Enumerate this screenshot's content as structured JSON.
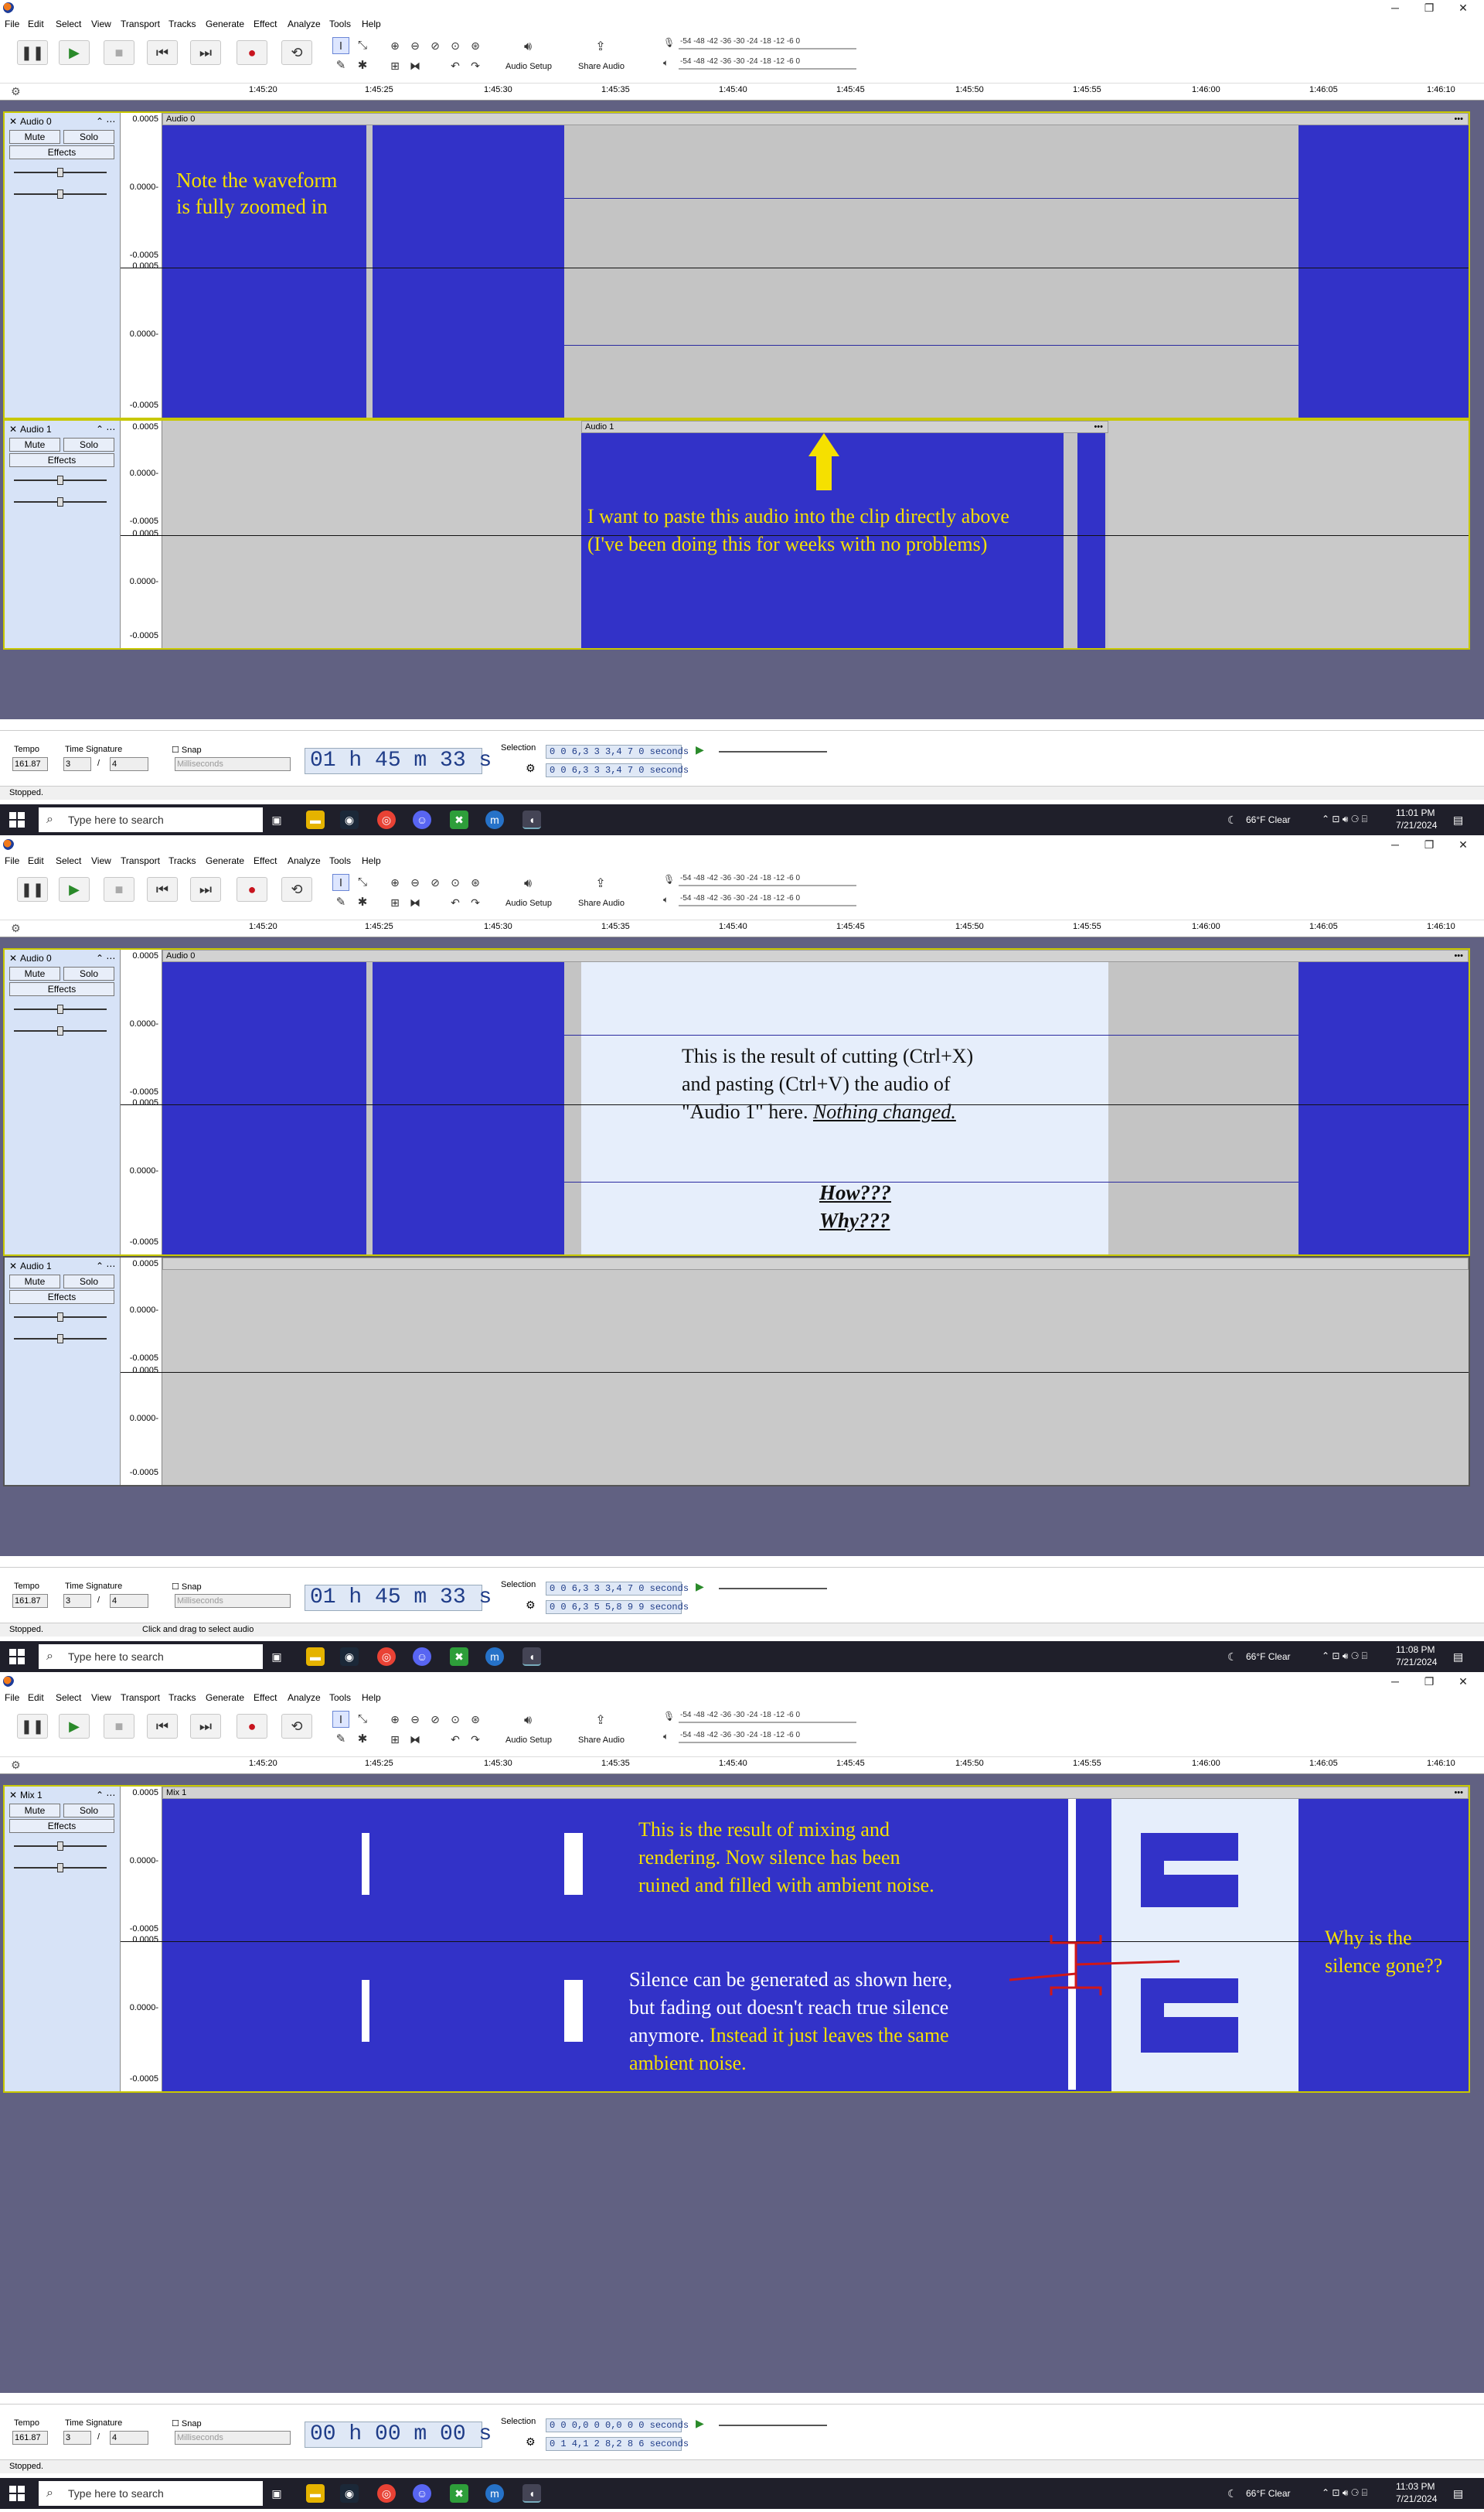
{
  "menu": [
    "File",
    "Edit",
    "Select",
    "View",
    "Transport",
    "Tracks",
    "Generate",
    "Effect",
    "Analyze",
    "Tools",
    "Help"
  ],
  "window": {
    "min": "─",
    "restore": "❐",
    "close": "✕"
  },
  "toolbar": {
    "audio_setup": "Audio Setup",
    "share_audio": "Share Audio",
    "meter_R": "R",
    "meter_L": "L",
    "meter_scale": "-54  -48  -42  -36  -30  -24  -18  -12   -6   0",
    "meter_scale2": "-54  -48  -42  -36  -30  -24  -18  -12   -6   0"
  },
  "ruler": [
    "1:45:20",
    "1:45:25",
    "1:45:30",
    "1:45:35",
    "1:45:40",
    "1:45:45",
    "1:45:50",
    "1:45:55",
    "1:46:00",
    "1:46:05",
    "1:46:10"
  ],
  "common": {
    "mute": "Mute",
    "solo": "Solo",
    "effects": "Effects",
    "pan_L": "L",
    "pan_R": "R",
    "gain_minus": "-",
    "gain_plus": "+",
    "tempo_label": "Tempo",
    "tempo": "161.87",
    "timesig_label": "Time Signature",
    "ts_num": "3",
    "ts_slash": "/",
    "ts_den": "4",
    "snap": "Snap",
    "snap_unit": "Milliseconds",
    "selection_label": "Selection",
    "search_placeholder": "Type here to search",
    "weather": "66°F  Clear",
    "vr_top": "0.0005",
    "vr_mid": "0.0000-",
    "vr_low": "-0.0005",
    "clip_menu": "•••"
  },
  "panels": [
    {
      "tracks": [
        {
          "name": "Audio 0",
          "clip": "Audio 0"
        },
        {
          "name": "Audio 1",
          "clip": "Audio 1"
        }
      ],
      "time": "01 h 45 m 33 s",
      "sel_start": "0 0 6,3 3 3,4 7 0  seconds",
      "sel_end": "0 0 6,3 3 3,4 7 0  seconds",
      "status": "Stopped.",
      "status_hint": "",
      "clock_time": "11:01 PM",
      "clock_date": "7/21/2024",
      "notes": {
        "a1": "Note the waveform",
        "a2": "is fully zoomed in",
        "b1": "I want to paste this audio into the clip directly above",
        "b2": "(I've been doing this for weeks with no problems)"
      }
    },
    {
      "tracks": [
        {
          "name": "Audio 0",
          "clip": "Audio 0"
        },
        {
          "name": "Audio 1",
          "clip": ""
        }
      ],
      "time": "01 h 45 m 33 s",
      "sel_start": "0 0 6,3 3 3,4 7 0  seconds",
      "sel_end": "0 0 6,3 5 5,8 9 9  seconds",
      "status": "Stopped.",
      "status_hint": "Click and drag to select audio",
      "clock_time": "11:08 PM",
      "clock_date": "7/21/2024",
      "notes": {
        "c1": "This is the result of cutting (Ctrl+X)",
        "c2": "and pasting (Ctrl+V) the audio of",
        "c3a": "\"Audio 1\" here. ",
        "c3b": "Nothing changed.",
        "c4": "How???",
        "c5": "Why???"
      }
    },
    {
      "tracks": [
        {
          "name": "Mix 1",
          "clip": "Mix 1"
        }
      ],
      "time": "00 h 00 m 00 s",
      "sel_start": "0 0 0,0 0 0,0 0 0  seconds",
      "sel_end": "0 1 4,1 2 8,2 8 6  seconds",
      "status": "Stopped.",
      "status_hint": "",
      "clock_time": "11:03 PM",
      "clock_date": "7/21/2024",
      "notes": {
        "d1": "This is the result of mixing and",
        "d2": "rendering. Now silence has been",
        "d3": "ruined and filled with ambient noise.",
        "e1": "Silence can be generated as shown here,",
        "e2": "but fading out doesn't reach true silence",
        "e3a": "anymore. ",
        "e3b": "Instead it just leaves the same",
        "e4": "ambient noise.",
        "f1": "Why is the",
        "f2": "silence gone??"
      }
    }
  ]
}
